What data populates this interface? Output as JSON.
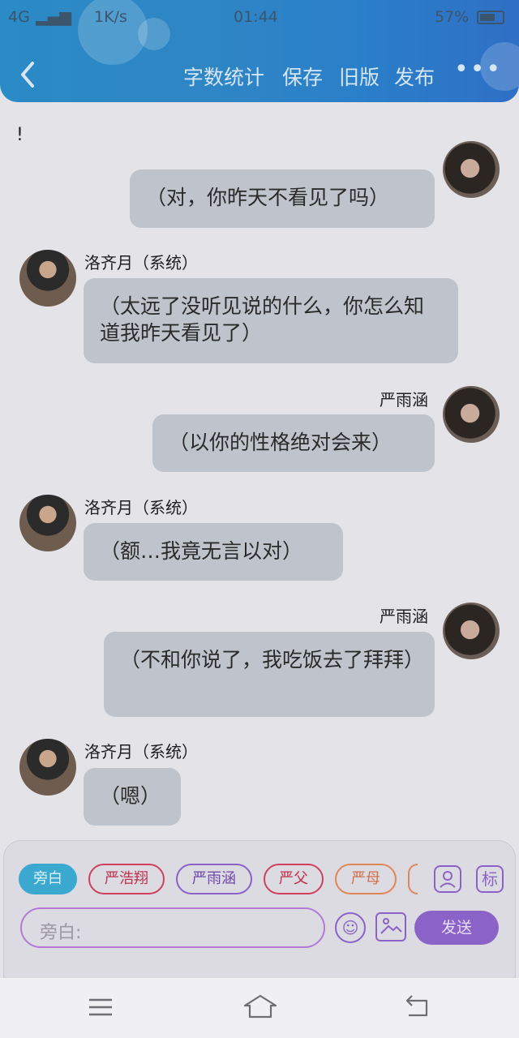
{
  "statusbar": {
    "network": "4G",
    "speed": "1K/s",
    "time": "01:44",
    "battery": "57%"
  },
  "navbar": {
    "back_icon": "chevron-left-icon",
    "items": [
      "字数统计",
      "保存",
      "旧版",
      "发布"
    ],
    "more": "•••"
  },
  "chat": {
    "leading_text": "!",
    "messages": [
      {
        "side": "right",
        "name": "",
        "text": "（对，你昨天不看见了吗）"
      },
      {
        "side": "left",
        "name": "洛齐月（系统）",
        "text": "（太远了没听见说的什么，你怎么知道我昨天看见了）"
      },
      {
        "side": "right",
        "name": "严雨涵",
        "text": "（以你的性格绝对会来）"
      },
      {
        "side": "left",
        "name": "洛齐月（系统）",
        "text": "（额…我竟无言以对）"
      },
      {
        "side": "right",
        "name": "严雨涵",
        "text": "（不和你说了，我吃饭去了拜拜）"
      },
      {
        "side": "left",
        "name": "洛齐月（系统）",
        "text": "（嗯）"
      }
    ]
  },
  "composer": {
    "chips": [
      {
        "label": "旁白",
        "active": true,
        "color": "#3aa8cf"
      },
      {
        "label": "严浩翔",
        "active": false,
        "color": "#d0405f"
      },
      {
        "label": "严雨涵",
        "active": false,
        "color": "#8a62c8"
      },
      {
        "label": "严父",
        "active": false,
        "color": "#d0405f"
      },
      {
        "label": "严母",
        "active": false,
        "color": "#e0865a"
      }
    ],
    "role_icon": "person-icon",
    "tag_icon_label": "标",
    "input_placeholder": "旁白:",
    "emoji_icon": "emoji-icon",
    "image_icon": "image-icon",
    "send_label": "发送"
  },
  "system_nav": {
    "menu_icon": "menu-icon",
    "home_icon": "home-icon",
    "back_icon": "back-icon"
  }
}
